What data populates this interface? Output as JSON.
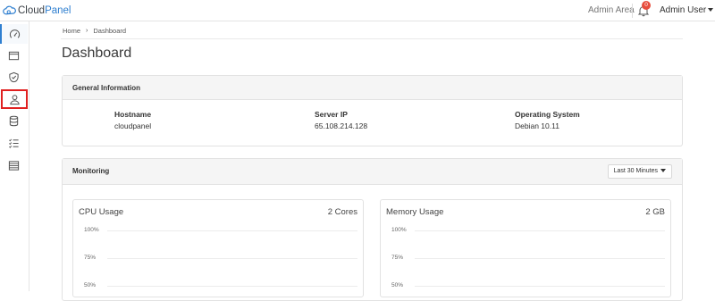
{
  "brand": {
    "part1": "Cloud",
    "part2": "Panel"
  },
  "topbar": {
    "admin_area": "Admin Area",
    "notifications": "0",
    "user": "Admin User"
  },
  "breadcrumb": {
    "home": "Home",
    "current": "Dashboard"
  },
  "page": {
    "title": "Dashboard"
  },
  "general": {
    "title": "General Information",
    "items": [
      {
        "label": "Hostname",
        "value": "cloudpanel"
      },
      {
        "label": "Server IP",
        "value": "65.108.214.128"
      },
      {
        "label": "Operating System",
        "value": "Debian 10.11"
      }
    ]
  },
  "monitoring": {
    "title": "Monitoring",
    "range": "Last 30 Minutes",
    "cpu": {
      "title": "CPU Usage",
      "meta": "2 Cores",
      "ticks": [
        "100%",
        "75%",
        "50%"
      ]
    },
    "memory": {
      "title": "Memory Usage",
      "meta": "2 GB",
      "ticks": [
        "100%",
        "75%",
        "50%"
      ]
    }
  },
  "colors": {
    "accent": "#2f7fd0",
    "highlight": "#e02020",
    "badge": "#e74c3c"
  },
  "sidebar": {
    "items": [
      {
        "icon": "dashboard-icon",
        "active": true
      },
      {
        "icon": "browser-window-icon"
      },
      {
        "icon": "shield-icon"
      },
      {
        "icon": "user-icon",
        "highlighted": true
      },
      {
        "icon": "database-icon"
      },
      {
        "icon": "tasks-list-icon"
      },
      {
        "icon": "table-icon"
      }
    ]
  }
}
